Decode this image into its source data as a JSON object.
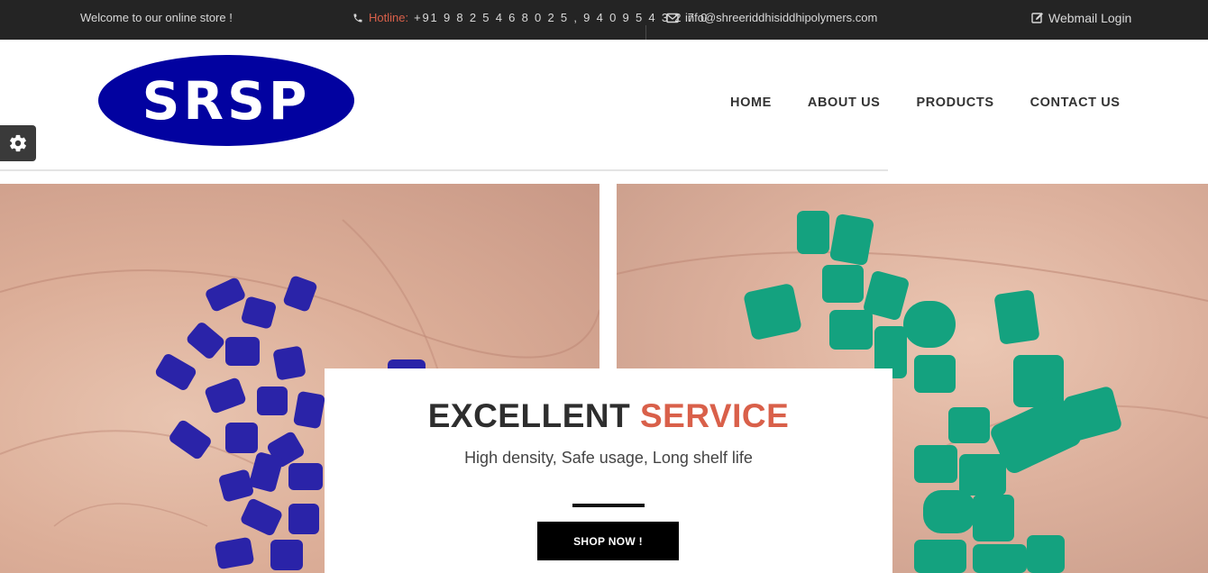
{
  "topbar": {
    "welcome": "Welcome to our online store !",
    "hotline_label": "Hotline:",
    "hotline_numbers": "+91 9 8 2 5 4 6 8 0 2 5 , 9 4 0 9 5 4 3 2 7 0",
    "email": "info@shreeriddhisiddhipolymers.com",
    "webmail": "Webmail Login"
  },
  "logo": {
    "text": "SRSP"
  },
  "nav": {
    "home": "HOME",
    "about": "ABOUT US",
    "products": "PRODUCTS",
    "contact": "CONTACT US"
  },
  "hero": {
    "title_main": "EXCELLENT",
    "title_accent": "SERVICE",
    "subtitle": "High density, Safe usage, Long shelf life",
    "button": "SHOP NOW !"
  },
  "colors": {
    "topbar_bg": "#242424",
    "accent": "#d9604a",
    "logo_blue": "#0202a0",
    "pellet_blue": "#2a23a8",
    "pellet_green": "#14a27f"
  },
  "icons": [
    "phone-icon",
    "envelope-icon",
    "edit-icon",
    "gear-icon"
  ]
}
